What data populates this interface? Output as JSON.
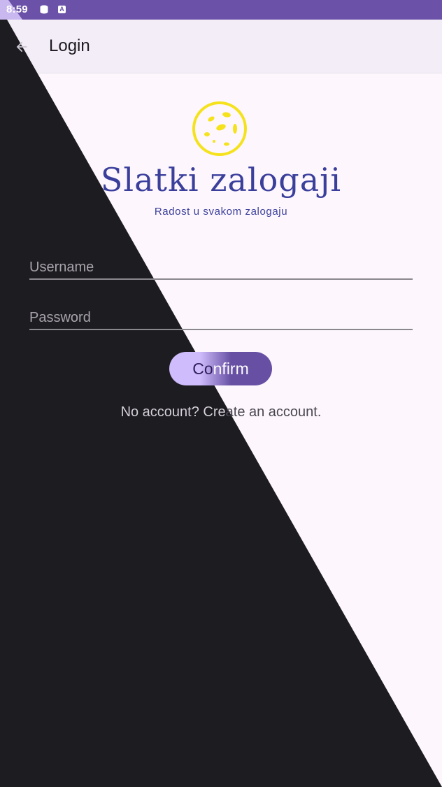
{
  "status_bar": {
    "time": "8:59",
    "icons": [
      "storage-icon",
      "accessibility-a-icon"
    ]
  },
  "app_bar": {
    "title": "Login",
    "back_icon": "arrow-back-icon"
  },
  "brand": {
    "logo_icon": "cookie-icon",
    "name": "Slatki zalogaji",
    "tagline": "Radost u svakom zalogaju"
  },
  "form": {
    "username_placeholder": "Username",
    "username_value": "",
    "password_placeholder": "Password",
    "password_value": "",
    "confirm_label": "Confirm",
    "create_account_text": "No account? Create an account."
  },
  "colors": {
    "status_bar": "#6b52a8",
    "app_bar": "#f3edf7",
    "page_bg": "#fdf7fd",
    "overlay": "#1d1c21",
    "brand": "#3b3f9c",
    "logo": "#f5e21d",
    "button_primary": "#6750a4",
    "button_light": "#cfbcfc"
  }
}
